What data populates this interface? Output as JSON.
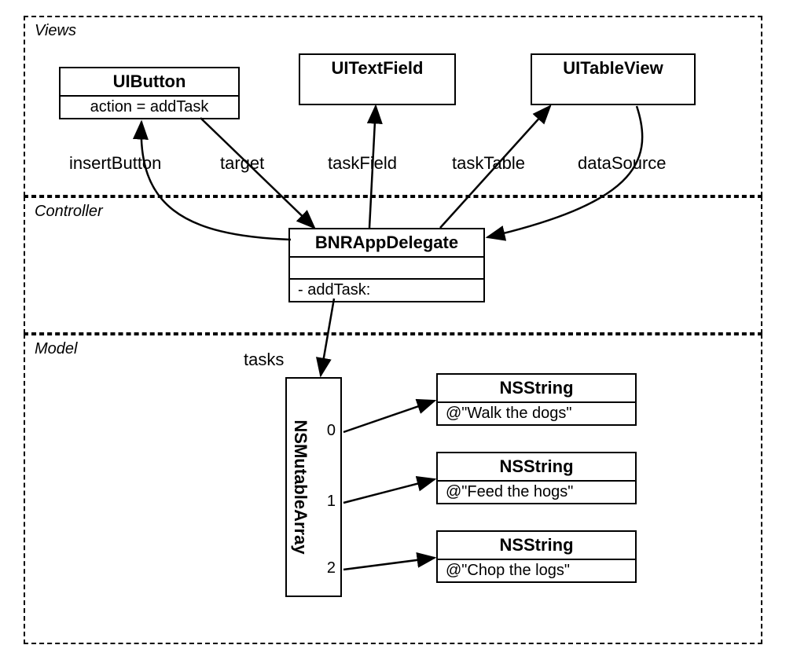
{
  "sections": {
    "views": "Views",
    "controller": "Controller",
    "model": "Model"
  },
  "views": {
    "uibutton": {
      "title": "UIButton",
      "action": "action = addTask"
    },
    "uitextfield": {
      "title": "UITextField"
    },
    "uitableview": {
      "title": "UITableView"
    }
  },
  "controller": {
    "title": "BNRAppDelegate",
    "method": "- addTask:"
  },
  "model": {
    "array_title": "NSMutableArray",
    "indices": [
      "0",
      "1",
      "2"
    ],
    "strings": [
      {
        "title": "NSString",
        "value": "@\"Walk the dogs\""
      },
      {
        "title": "NSString",
        "value": "@\"Feed the hogs\""
      },
      {
        "title": "NSString",
        "value": "@\"Chop the logs\""
      }
    ]
  },
  "labels": {
    "insertButton": "insertButton",
    "target": "target",
    "taskField": "taskField",
    "taskTable": "taskTable",
    "dataSource": "dataSource",
    "tasks": "tasks"
  }
}
